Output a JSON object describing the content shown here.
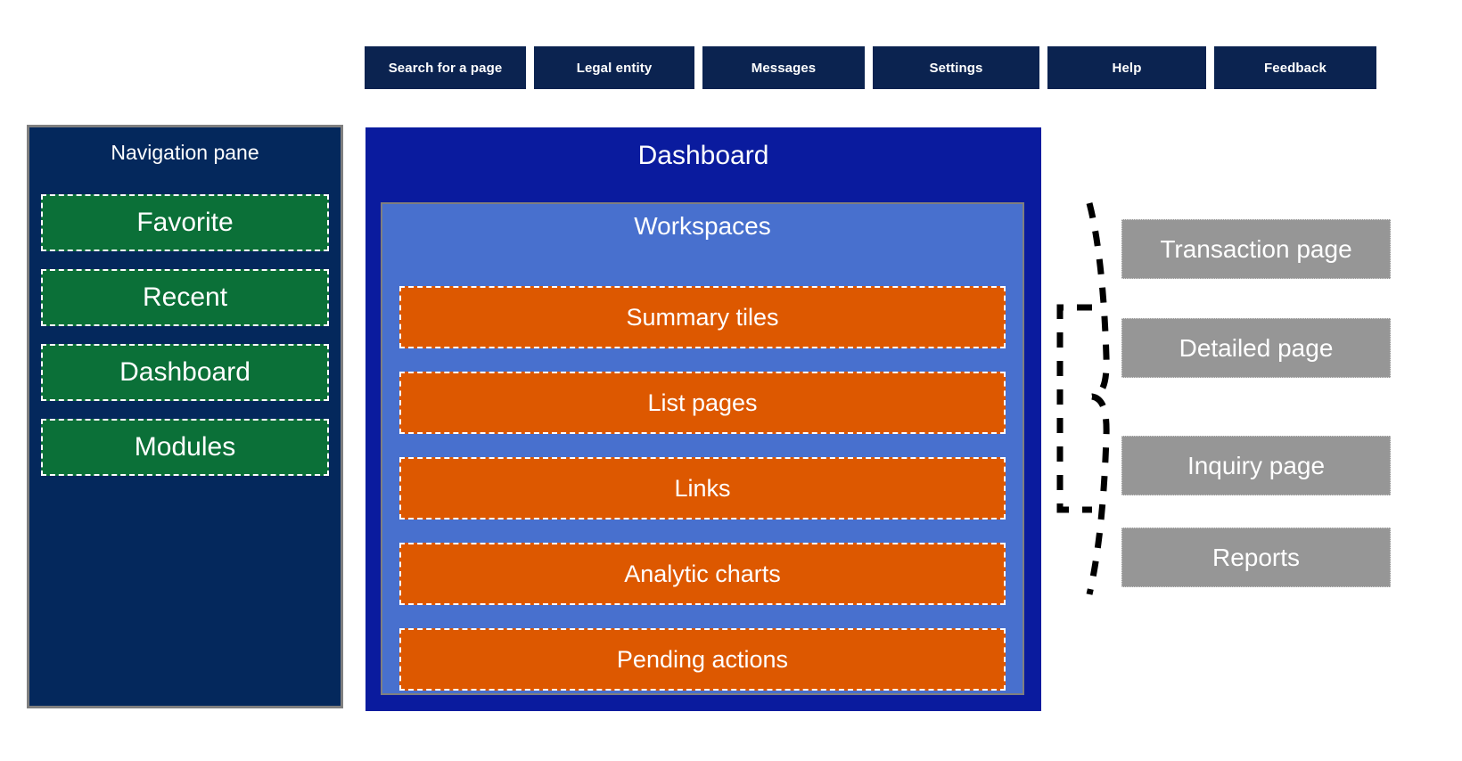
{
  "topbar": {
    "buttons": [
      {
        "label": "Search for a page",
        "name": "search-for-a-page-button"
      },
      {
        "label": "Legal entity",
        "name": "legal-entity-button"
      },
      {
        "label": "Messages",
        "name": "messages-button"
      },
      {
        "label": "Settings",
        "name": "settings-button"
      },
      {
        "label": "Help",
        "name": "help-button"
      },
      {
        "label": "Feedback",
        "name": "feedback-button"
      }
    ]
  },
  "navigation_pane": {
    "title": "Navigation pane",
    "items": [
      {
        "label": "Favorite"
      },
      {
        "label": "Recent"
      },
      {
        "label": "Dashboard"
      },
      {
        "label": "Modules"
      }
    ]
  },
  "dashboard": {
    "title": "Dashboard",
    "workspaces": {
      "title": "Workspaces",
      "tiles": [
        {
          "label": "Summary tiles"
        },
        {
          "label": "List pages"
        },
        {
          "label": "Links"
        },
        {
          "label": "Analytic charts"
        },
        {
          "label": "Pending actions"
        }
      ]
    }
  },
  "page_targets": {
    "items": [
      {
        "label": "Transaction page"
      },
      {
        "label": "Detailed page"
      },
      {
        "label": "Inquiry page"
      },
      {
        "label": "Reports"
      }
    ]
  },
  "colors": {
    "topbar_button": "#0B2350",
    "nav_pane_bg": "#04285C",
    "nav_item_green": "#0B7038",
    "dashboard_blue": "#0A1B9E",
    "workspaces_blue": "#4870CE",
    "tile_orange": "#DD5800",
    "gray_box": "#969696",
    "border_gray": "#7F7F7F",
    "text_white": "#FFFFFF"
  }
}
